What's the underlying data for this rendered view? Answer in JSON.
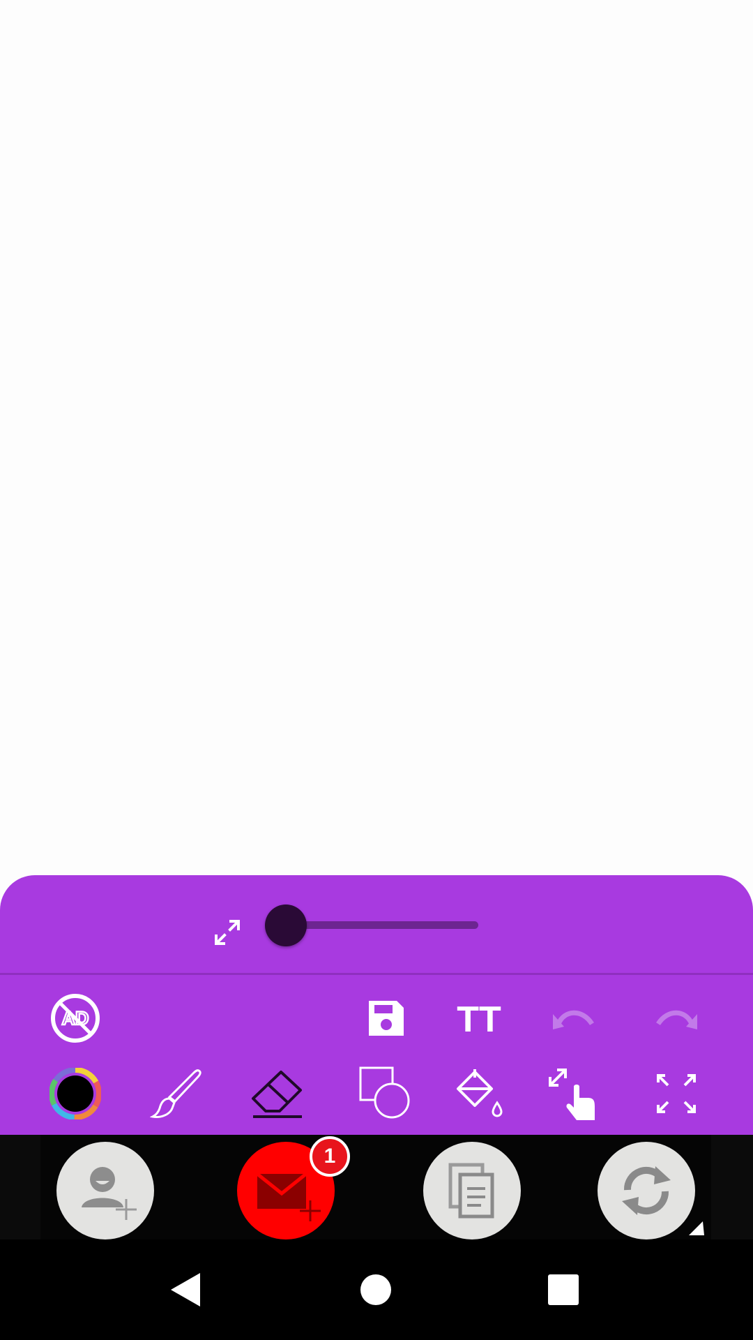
{
  "canvas": {
    "background": "#fdfdfd"
  },
  "toolbar": {
    "accent": "#a83ae0",
    "brush_size": 0.0,
    "row1": [
      {
        "name": "no-ads-icon",
        "label": "AD",
        "enabled": true
      },
      {
        "name": "save-icon",
        "enabled": true
      },
      {
        "name": "text-size-icon",
        "label": "TT",
        "enabled": true
      },
      {
        "name": "undo-icon",
        "enabled": false
      },
      {
        "name": "redo-icon",
        "enabled": false
      }
    ],
    "row2": [
      {
        "name": "color-picker-icon",
        "current_color": "#000000"
      },
      {
        "name": "brush-icon"
      },
      {
        "name": "eraser-icon"
      },
      {
        "name": "shapes-icon"
      },
      {
        "name": "fill-bucket-icon"
      },
      {
        "name": "pan-zoom-icon"
      },
      {
        "name": "fullscreen-icon"
      }
    ]
  },
  "ad_bar": {
    "buttons": [
      {
        "name": "add-contact-icon",
        "color": "#e3e3e1"
      },
      {
        "name": "mail-icon",
        "color": "#ff0000",
        "badge": "1"
      },
      {
        "name": "copy-document-icon",
        "color": "#e3e3e1"
      },
      {
        "name": "refresh-icon",
        "color": "#e3e3e1"
      }
    ]
  },
  "navbar": {
    "buttons": [
      "back-icon",
      "home-icon",
      "recents-icon"
    ]
  }
}
